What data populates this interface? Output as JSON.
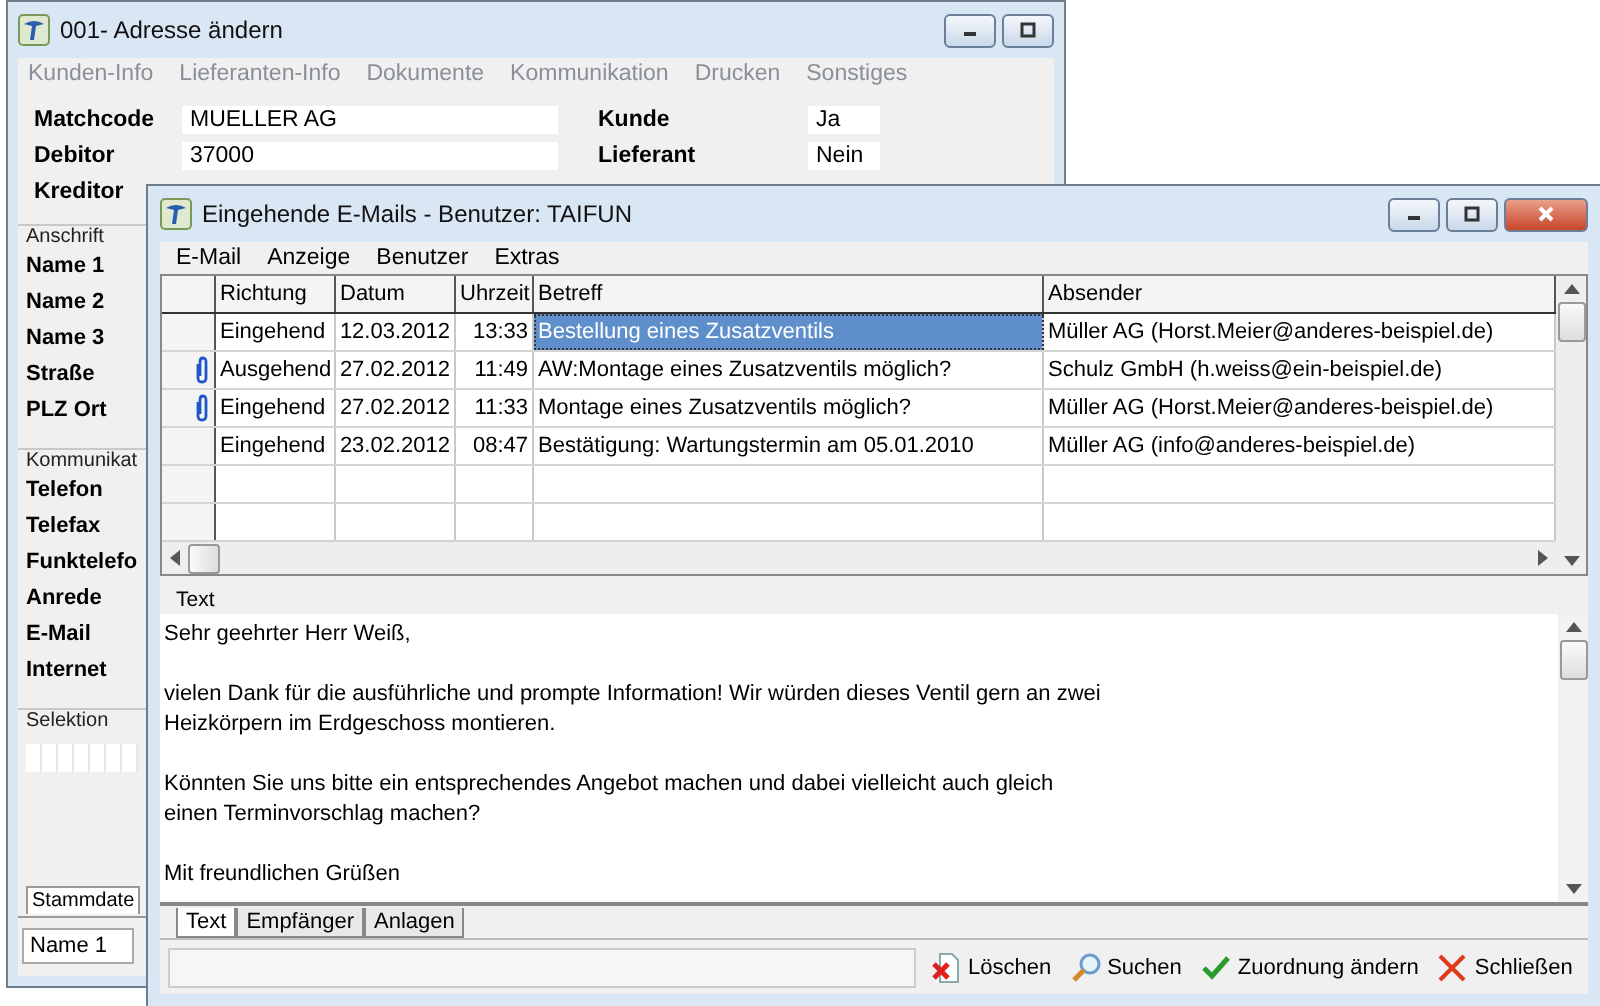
{
  "back_window": {
    "title": "001- Adresse ändern",
    "menu": [
      {
        "label": "Kunden-Info",
        "disabled": true
      },
      {
        "label": "Lieferanten-Info",
        "disabled": true
      },
      {
        "label": "Dokumente",
        "disabled": true
      },
      {
        "label": "Kommunikation",
        "disabled": true
      },
      {
        "label": "Drucken",
        "disabled": true
      },
      {
        "label": "Sonstiges",
        "disabled": true
      }
    ],
    "fields_left": [
      {
        "label": "Matchcode",
        "value": "MUELLER AG"
      },
      {
        "label": "Debitor",
        "value": "37000"
      },
      {
        "label": "Kreditor"
      }
    ],
    "fields_right": [
      {
        "label": "Kunde",
        "value": "Ja"
      },
      {
        "label": "Lieferant",
        "value": "Nein"
      }
    ],
    "groups": [
      {
        "title": "Anschrift",
        "labels": [
          "Name 1",
          "Name 2",
          "Name 3",
          "Straße",
          "PLZ Ort"
        ]
      },
      {
        "title": "Kommunikat",
        "labels": [
          "Telefon",
          "Telefax",
          "Funktelefo",
          "Anrede",
          "E-Mail",
          "Internet"
        ]
      },
      {
        "title": "Selektion"
      }
    ],
    "tab": "Stammdate",
    "bottom_field": "Name 1"
  },
  "mail_window": {
    "title": "Eingehende E-Mails - Benutzer: TAIFUN",
    "menu": [
      "E-Mail",
      "Anzeige",
      "Benutzer",
      "Extras"
    ],
    "columns": [
      "Richtung",
      "Datum",
      "Uhrzeit",
      "Betreff",
      "Absender"
    ],
    "rows": [
      {
        "attachment": false,
        "selected": true,
        "cells": [
          "Eingehend",
          "12.03.2012",
          "13:33",
          "Bestellung eines Zusatzventils",
          "Müller AG (Horst.Meier@anderes-beispiel.de)"
        ]
      },
      {
        "attachment": true,
        "selected": false,
        "cells": [
          "Ausgehend",
          "27.02.2012",
          "11:49",
          "AW:Montage eines Zusatzventils möglich?",
          "Schulz GmbH (h.weiss@ein-beispiel.de)"
        ]
      },
      {
        "attachment": true,
        "selected": false,
        "cells": [
          "Eingehend",
          "27.02.2012",
          "11:33",
          "Montage eines Zusatzventils möglich?",
          "Müller AG (Horst.Meier@anderes-beispiel.de)"
        ]
      },
      {
        "attachment": false,
        "selected": false,
        "cells": [
          "Eingehend",
          "23.02.2012",
          "08:47",
          "Bestätigung: Wartungstermin am 05.01.2010",
          "Müller AG (info@anderes-beispiel.de)"
        ]
      }
    ],
    "text_label": "Text",
    "paragraphs": [
      [
        "Sehr geehrter Herr Weiß,"
      ],
      [
        "vielen Dank für die ausführliche und prompte Information! Wir würden dieses Ventil gern an zwei",
        "Heizkörpern im Erdgeschoss montieren."
      ],
      [
        "Könnten Sie uns bitte ein entsprechendes Angebot machen und dabei vielleicht auch gleich",
        "einen Terminvorschlag machen?"
      ],
      [
        "Mit freundlichen Grüßen"
      ]
    ],
    "tabs": [
      {
        "label": "Text",
        "selected": true
      },
      {
        "label": "Empfänger",
        "selected": false
      },
      {
        "label": "Anlagen",
        "selected": false
      }
    ],
    "buttons": [
      {
        "kind": "delete",
        "label": "Löschen"
      },
      {
        "kind": "search",
        "label": "Suchen"
      },
      {
        "kind": "assign",
        "label": "Zuordnung ändern"
      },
      {
        "kind": "close",
        "label": "Schließen"
      }
    ]
  }
}
